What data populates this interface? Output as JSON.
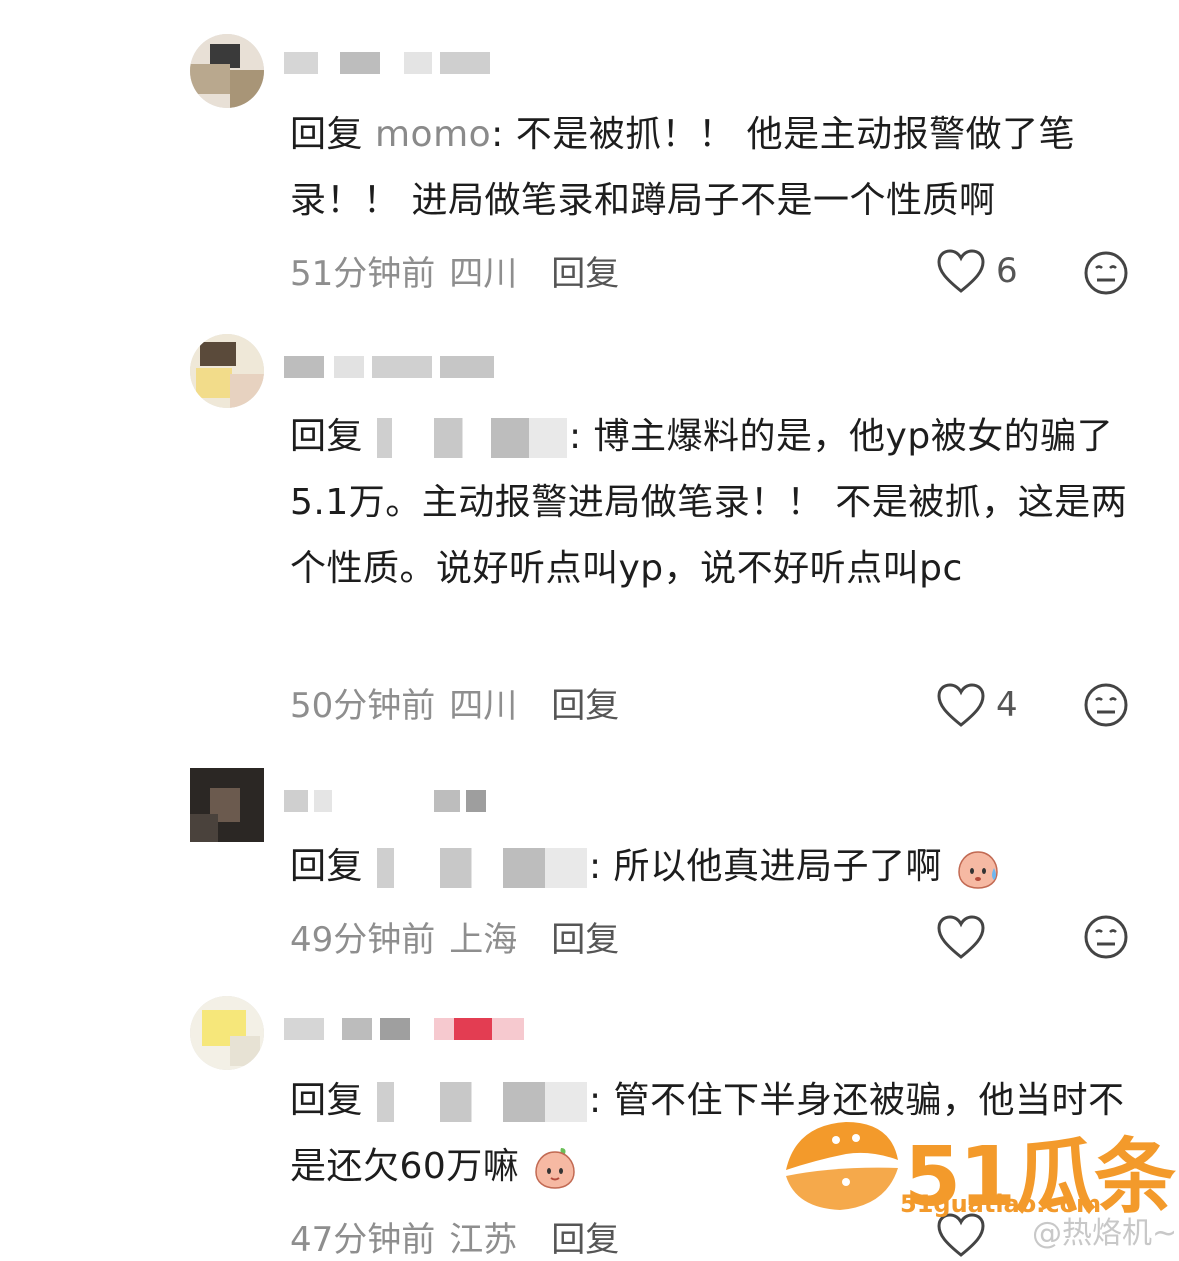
{
  "comments": [
    {
      "reply_prefix": "回复",
      "mention": "momo",
      "text": ": 不是被抓！！ 他是主动报警做了笔录！！ 进局做笔录和蹲局子不是一个性质啊",
      "time": "51分钟前",
      "location": "四川",
      "reply_label": "回复",
      "likes": "6"
    },
    {
      "reply_prefix": "回复",
      "text": ": 博主爆料的是，他yp被女的骗了5.1万。主动报警进局做笔录！！ 不是被抓，这是两个性质。说好听点叫yp，说不好听点叫pc",
      "time": "50分钟前",
      "location": "四川",
      "reply_label": "回复",
      "likes": "4"
    },
    {
      "reply_prefix": "回复",
      "text": ": 所以他真进局子了啊",
      "time": "49分钟前",
      "location": "上海",
      "reply_label": "回复",
      "likes": ""
    },
    {
      "reply_prefix": "回复",
      "text": ": 管不住下半身还被骗，他当时不是还欠60万嘛",
      "time": "47分钟前",
      "location": "江苏",
      "reply_label": "回复",
      "likes": ""
    }
  ],
  "watermark": {
    "logo_text": "51瓜条",
    "url": "51guatiao.com",
    "weibo": "@热烙机~"
  },
  "icons": {
    "like": "heart-outline-icon",
    "dislike": "neutral-face-icon",
    "emoji_sweat": "peach-sweat-emoji-icon",
    "emoji_peach": "peach-emoji-icon"
  },
  "colors": {
    "accent": "#f39a2b",
    "meta": "#8e8e8e"
  }
}
